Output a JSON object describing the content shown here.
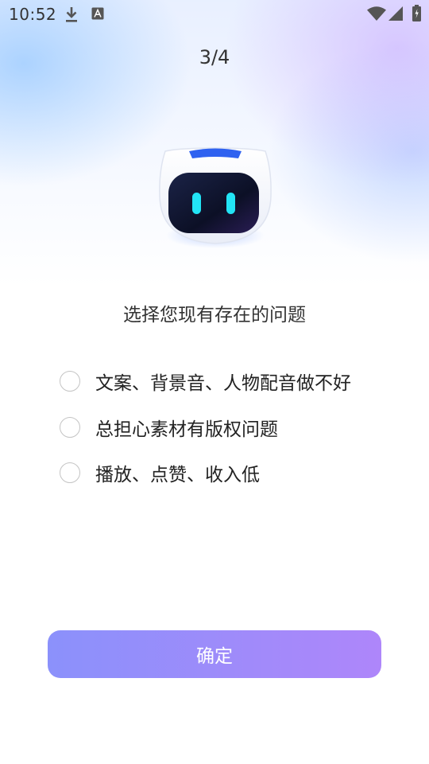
{
  "status_bar": {
    "time": "10:52",
    "icons": [
      "download-icon",
      "font-icon",
      "wifi-icon",
      "signal-icon",
      "battery-icon"
    ]
  },
  "progress": {
    "label": "3/4",
    "current": 3,
    "total": 4
  },
  "mascot": {
    "icon": "robot-mascot-icon"
  },
  "question": {
    "title": "选择您现有存在的问题"
  },
  "options": [
    {
      "label": "文案、背景音、人物配音做不好",
      "selected": false
    },
    {
      "label": "总担心素材有版权问题",
      "selected": false
    },
    {
      "label": "播放、点赞、收入低",
      "selected": false
    }
  ],
  "confirm_button": {
    "label": "确定"
  },
  "colors": {
    "button_gradient_start": "#8b91fb",
    "button_gradient_end": "#ae86fa",
    "robot_cap": "#2f62f0",
    "robot_eyes": "#22e4f5",
    "robot_face": "#101630",
    "radio_border": "#c4c4c4"
  }
}
